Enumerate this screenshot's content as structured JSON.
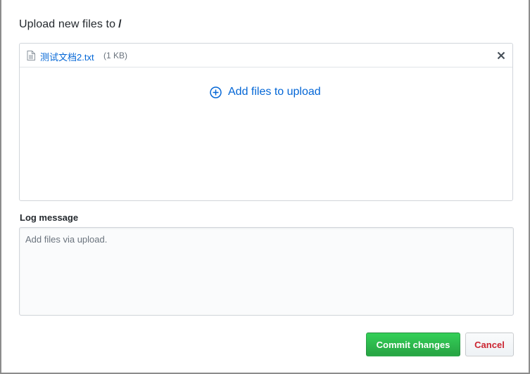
{
  "heading": {
    "text": "Upload new files to",
    "path": "/"
  },
  "files": [
    {
      "name": "测试文档2.txt",
      "size": "(1 KB)"
    }
  ],
  "upload": {
    "add_label": "Add files to upload"
  },
  "log": {
    "label": "Log message",
    "placeholder": "Add files via upload.",
    "value": ""
  },
  "buttons": {
    "commit": "Commit changes",
    "cancel": "Cancel"
  },
  "colors": {
    "link": "#0366d6",
    "commit_bg": "#2ea44f",
    "cancel_text": "#cb2431",
    "border": "#d1d5da"
  },
  "icons": {
    "file": "file-icon",
    "remove": "close-icon",
    "add": "plus-circle-icon"
  }
}
